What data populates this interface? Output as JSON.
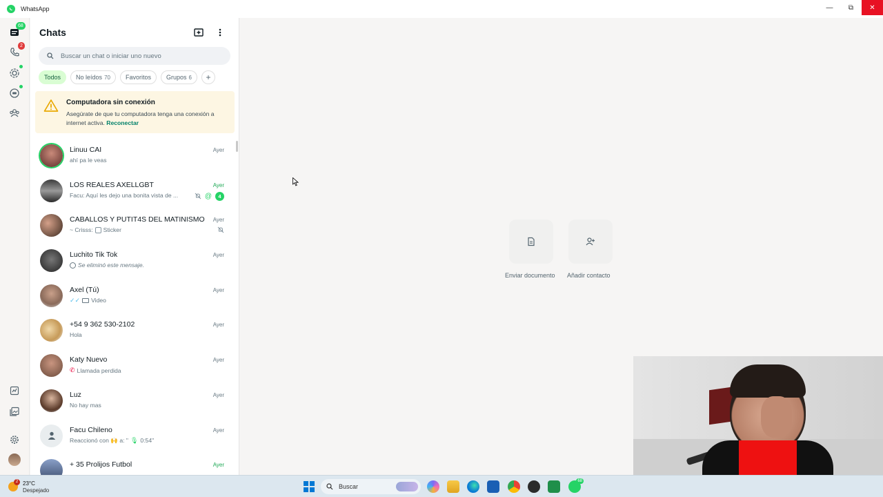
{
  "window": {
    "title": "WhatsApp",
    "minimize": "—",
    "maximize": "⧉",
    "close": "✕"
  },
  "rail": {
    "chats_badge": "68",
    "calls_badge": "2"
  },
  "sidebar": {
    "title": "Chats",
    "search_placeholder": "Buscar un chat o iniciar uno nuevo",
    "filters": [
      {
        "label": "Todos",
        "count": ""
      },
      {
        "label": "No leídos",
        "count": "70"
      },
      {
        "label": "Favoritos",
        "count": ""
      },
      {
        "label": "Grupos",
        "count": "6"
      }
    ],
    "add_filter": "+",
    "banner": {
      "title": "Computadora sin conexión",
      "text": "Asegúrate de que tu computadora tenga una conexión a internet activa.",
      "link": "Reconectar"
    },
    "chats": [
      {
        "name": "Linuu CAI",
        "preview": "ahí pa le veas",
        "time": "Ayer"
      },
      {
        "name": "LOS REALES AXELLGBT",
        "preview": "Facu: Aquí les dejo una bonita vista de ...",
        "time": "Ayer",
        "unread": "4"
      },
      {
        "name": "CABALLOS Y PUTIT4S DEL MATINISMO",
        "preview_sender": "~ Crisss:",
        "preview": "Sticker",
        "time": "Ayer"
      },
      {
        "name": "Luchito Tik Tok",
        "preview": "Se eliminó este mensaje.",
        "time": "Ayer"
      },
      {
        "name": "Axel (Tú)",
        "preview": "Video",
        "time": "Ayer"
      },
      {
        "name": "+54 9 362 530-2102",
        "preview": "Hola",
        "time": "Ayer"
      },
      {
        "name": "Katy Nuevo",
        "preview": "Llamada perdida",
        "time": "Ayer"
      },
      {
        "name": "Luz",
        "preview": "No hay mas",
        "time": "Ayer"
      },
      {
        "name": "Facu Chileno",
        "preview": "Reaccionó con 🙌 a: \"",
        "preview_extra": "0:54\"",
        "time": "Ayer"
      },
      {
        "name": "+ 35 Prolijos Futbol",
        "preview": "",
        "time": "Ayer"
      }
    ]
  },
  "main": {
    "actions": [
      {
        "label": "Enviar documento",
        "icon": "document-icon"
      },
      {
        "label": "Añadir contacto",
        "icon": "add-contact-icon"
      }
    ]
  },
  "taskbar": {
    "weather_temp": "23°C",
    "weather_desc": "Despejado",
    "weather_badge": "2",
    "search_label": "Buscar",
    "whatsapp_badge": "68"
  },
  "colors": {
    "accent": "#25d366",
    "banner_bg": "#fdf6e3",
    "active_chip": "#d9fdd3",
    "close_red": "#e81123"
  }
}
